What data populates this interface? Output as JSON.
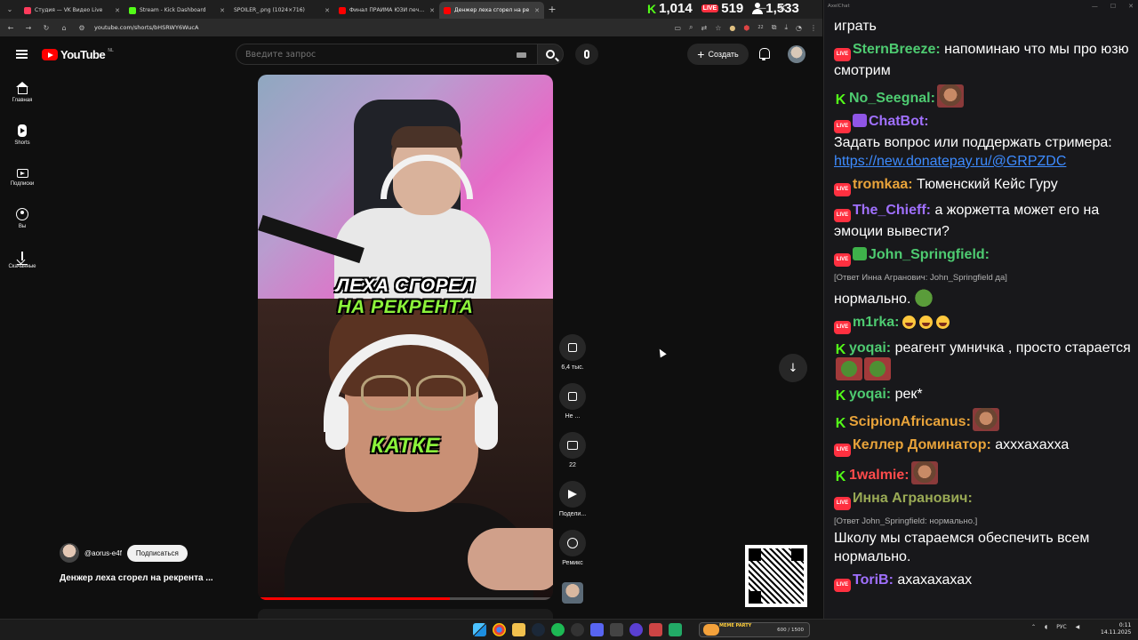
{
  "browser": {
    "tabs": [
      {
        "label": "Студия — VK Видео Live",
        "color": "#ff3b5c"
      },
      {
        "label": "Stream - Kick Dashboard",
        "color": "#53fc18"
      },
      {
        "label": "SPOILER_.png (1024×716)",
        "color": "#3c3c3c"
      },
      {
        "label": "Финал ПРАЙМА ЮЗИ печальн",
        "color": "#ff0000"
      },
      {
        "label": "Денжер леха сгорел на ре",
        "color": "#ff0000"
      }
    ],
    "url": "youtube.com/shorts/bHSRWY6WucA",
    "ext_badge": "22"
  },
  "viewer_stats": {
    "kick": "1,014",
    "vk": "519",
    "vk_badge": "LIVE",
    "total": "1,533"
  },
  "youtube": {
    "logo": "YouTube",
    "logo_region": "NL",
    "search_placeholder": "Введите запрос",
    "create_label": "Создать",
    "sidebar": [
      {
        "label": "Главная",
        "icon": "home-icon"
      },
      {
        "label": "Shorts",
        "icon": "shorts-icon"
      },
      {
        "label": "Подписки",
        "icon": "subscriptions-icon"
      },
      {
        "label": "Вы",
        "icon": "you-icon"
      },
      {
        "label": "Скачанные",
        "icon": "downloads-icon"
      }
    ],
    "captions": [
      "ЛЕХА СГОРЕЛ",
      "НА РЕКРЕНТА",
      "КАТКЕ"
    ],
    "progress_fraction": 0.65,
    "actions": {
      "likes": "6,4 тыс.",
      "dislike": "Не ...",
      "comments": "22",
      "share": "Подели...",
      "remix": "Ремикс"
    },
    "channel": "@aorus-e4f",
    "subscribe": "Подписаться",
    "title": "Денжер леха сгорел на рекрента ..."
  },
  "chat": {
    "app_title": "AxelChat",
    "messages": [
      {
        "platform": "vk",
        "name": "",
        "text": "играть"
      },
      {
        "platform": "vk",
        "name": "SternBreeze:",
        "name_color": "#4ecb71",
        "text": "напоминаю что мы про юзю смотрим"
      },
      {
        "platform": "kick",
        "name": "No_Seegnal:",
        "name_color": "#4ecb71",
        "text": ""
      },
      {
        "platform": "vk",
        "name": "ChatBot:",
        "name_color": "#a070ff",
        "text": "Задать вопрос или поддержать стримера:",
        "link": "https://new.donatepay.ru/@GRPZDC"
      },
      {
        "platform": "vk",
        "name": "tromkaa:",
        "name_color": "#e8a33a",
        "text": "Тюменский Кейс Гуру"
      },
      {
        "platform": "vk",
        "name": "The_Chieff:",
        "name_color": "#a070ff",
        "text": "а жоржетта может его на эмоции вывести?"
      },
      {
        "platform": "vk",
        "name": "John_Springfield:",
        "name_color": "#4ecb71",
        "reply": "[Ответ Инна Агранович: John_Springfield да]",
        "text": "нормально."
      },
      {
        "platform": "vk",
        "name": "m1rka:",
        "name_color": "#4ecb71",
        "text": ""
      },
      {
        "platform": "kick",
        "name": "yoqai:",
        "name_color": "#4ecb71",
        "text": "реагент умничка , просто старается"
      },
      {
        "platform": "kick",
        "name": "yoqai:",
        "name_color": "#4ecb71",
        "text": "рек*"
      },
      {
        "platform": "kick",
        "name": "ScipionAfricanus:",
        "name_color": "#e8a33a",
        "text": ""
      },
      {
        "platform": "vk",
        "name": "Келлер Доминатор:",
        "name_color": "#e8a33a",
        "text": "ахххахахха"
      },
      {
        "platform": "kick",
        "name": "1walmie:",
        "name_color": "#ff4b4b",
        "text": ""
      },
      {
        "platform": "vk",
        "name": "Инна Агранович:",
        "name_color": "#9aaa55",
        "reply": "[Ответ John_Springfield: нормально.]",
        "text": "Школу мы стараемся обеспечить всем нормально."
      },
      {
        "platform": "vk",
        "name": "ToriB:",
        "name_color": "#a070ff",
        "text": "ахахахахах"
      }
    ]
  },
  "taskbar": {
    "widget_label": "MEME PARTY",
    "widget_value": "600 / 1500",
    "lang": "РУС",
    "time": "0:11",
    "date": "14.11.2025"
  }
}
